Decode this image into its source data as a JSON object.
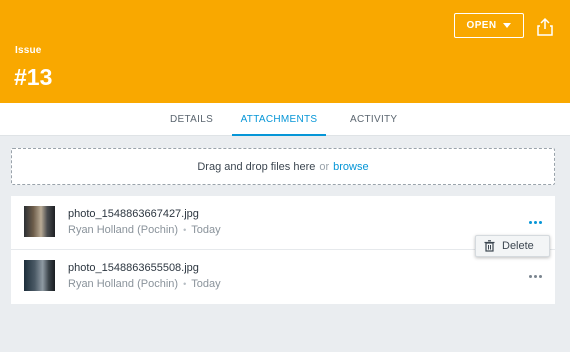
{
  "header": {
    "label": "Issue",
    "number": "#13",
    "status": "OPEN",
    "color": "#f9a800"
  },
  "tabs": [
    {
      "label": "DETAILS",
      "active": false
    },
    {
      "label": "ATTACHMENTS",
      "active": true
    },
    {
      "label": "ACTIVITY",
      "active": false
    }
  ],
  "dropzone": {
    "text": "Drag and drop files here",
    "or": "or",
    "browse": "browse"
  },
  "attachments": [
    {
      "filename": "photo_1548863667427.jpg",
      "author": "Ryan Holland (Pochin)",
      "date": "Today"
    },
    {
      "filename": "photo_1548863655508.jpg",
      "author": "Ryan Holland (Pochin)",
      "date": "Today"
    }
  ],
  "context_menu": {
    "delete_label": "Delete",
    "icon": "trash-icon"
  },
  "colors": {
    "accent": "#0696d7",
    "background": "#eaedf0"
  }
}
